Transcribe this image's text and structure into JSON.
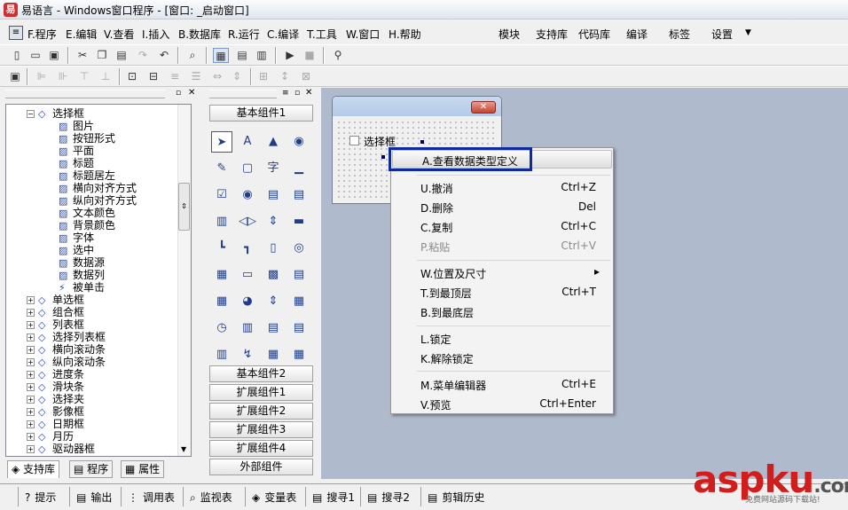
{
  "window": {
    "title": "易语言 - Windows窗口程序 - [窗口: _启动窗口]",
    "app_icon": "易"
  },
  "menu": {
    "items": [
      "F.程序",
      "E.编辑",
      "V.查看",
      "I.插入",
      "B.数据库",
      "R.运行",
      "C.编译",
      "T.工具",
      "W.窗口",
      "H.帮助"
    ],
    "right_items": [
      "模块",
      "支持库",
      "代码库",
      "编译",
      "标签",
      "设置"
    ]
  },
  "tree": {
    "items": [
      {
        "label": "选择框",
        "type": "folder",
        "expander": "−"
      },
      {
        "label": "图片",
        "type": "prop"
      },
      {
        "label": "按钮形式",
        "type": "prop"
      },
      {
        "label": "平面",
        "type": "prop"
      },
      {
        "label": "标题",
        "type": "prop"
      },
      {
        "label": "标题居左",
        "type": "prop"
      },
      {
        "label": "横向对齐方式",
        "type": "prop"
      },
      {
        "label": "纵向对齐方式",
        "type": "prop"
      },
      {
        "label": "文本颜色",
        "type": "prop"
      },
      {
        "label": "背景颜色",
        "type": "prop"
      },
      {
        "label": "字体",
        "type": "prop"
      },
      {
        "label": "选中",
        "type": "prop"
      },
      {
        "label": "数据源",
        "type": "prop"
      },
      {
        "label": "数据列",
        "type": "prop"
      },
      {
        "label": "被单击",
        "type": "event"
      },
      {
        "label": "单选框",
        "type": "folder",
        "expander": "+"
      },
      {
        "label": "组合框",
        "type": "folder",
        "expander": "+"
      },
      {
        "label": "列表框",
        "type": "folder",
        "expander": "+"
      },
      {
        "label": "选择列表框",
        "type": "folder",
        "expander": "+"
      },
      {
        "label": "横向滚动条",
        "type": "folder",
        "expander": "+"
      },
      {
        "label": "纵向滚动条",
        "type": "folder",
        "expander": "+"
      },
      {
        "label": "进度条",
        "type": "folder",
        "expander": "+"
      },
      {
        "label": "滑块条",
        "type": "folder",
        "expander": "+"
      },
      {
        "label": "选择夹",
        "type": "folder",
        "expander": "+"
      },
      {
        "label": "影像框",
        "type": "folder",
        "expander": "+"
      },
      {
        "label": "日期框",
        "type": "folder",
        "expander": "+"
      },
      {
        "label": "月历",
        "type": "folder",
        "expander": "+"
      },
      {
        "label": "驱动器框",
        "type": "folder",
        "expander": "+"
      }
    ]
  },
  "left_tabs": [
    "支持库",
    "程序",
    "属性"
  ],
  "components": {
    "top_group": "基本组件1",
    "groups": [
      "基本组件2",
      "扩展组件1",
      "扩展组件2",
      "扩展组件3",
      "扩展组件4",
      "外部组件"
    ]
  },
  "form": {
    "checkbox_label": "选择框",
    "close_glyph": "✕"
  },
  "context_menu": {
    "items": [
      {
        "label": "A.查看数据类型定义",
        "shortcut": "",
        "disabled": false
      },
      {
        "label": "U.撤消",
        "shortcut": "Ctrl+Z",
        "disabled": false
      },
      {
        "label": "D.删除",
        "shortcut": "Del",
        "disabled": false
      },
      {
        "label": "C.复制",
        "shortcut": "Ctrl+C",
        "disabled": false
      },
      {
        "label": "P.粘贴",
        "shortcut": "Ctrl+V",
        "disabled": true
      },
      {
        "label": "W.位置及尺寸",
        "shortcut": "▸",
        "disabled": false
      },
      {
        "label": "T.到最顶层",
        "shortcut": "Ctrl+T",
        "disabled": false
      },
      {
        "label": "B.到最底层",
        "shortcut": "",
        "disabled": false
      },
      {
        "label": "L.锁定",
        "shortcut": "",
        "disabled": false
      },
      {
        "label": "K.解除锁定",
        "shortcut": "",
        "disabled": false
      },
      {
        "label": "M.菜单编辑器",
        "shortcut": "Ctrl+E",
        "disabled": false
      },
      {
        "label": "V.预览",
        "shortcut": "Ctrl+Enter",
        "disabled": false
      }
    ]
  },
  "statusbar": {
    "items": [
      "提示",
      "输出",
      "调用表",
      "监视表",
      "变量表",
      "搜寻1",
      "搜寻2",
      "剪辑历史"
    ]
  },
  "watermark": {
    "main": "aspku",
    "suffix": ".com",
    "sub": "免费网站源码下载站!"
  },
  "colors": {
    "design_bg": "#afbacd",
    "highlight_border": "#0f2a9e",
    "watermark": "#d21d1d"
  }
}
